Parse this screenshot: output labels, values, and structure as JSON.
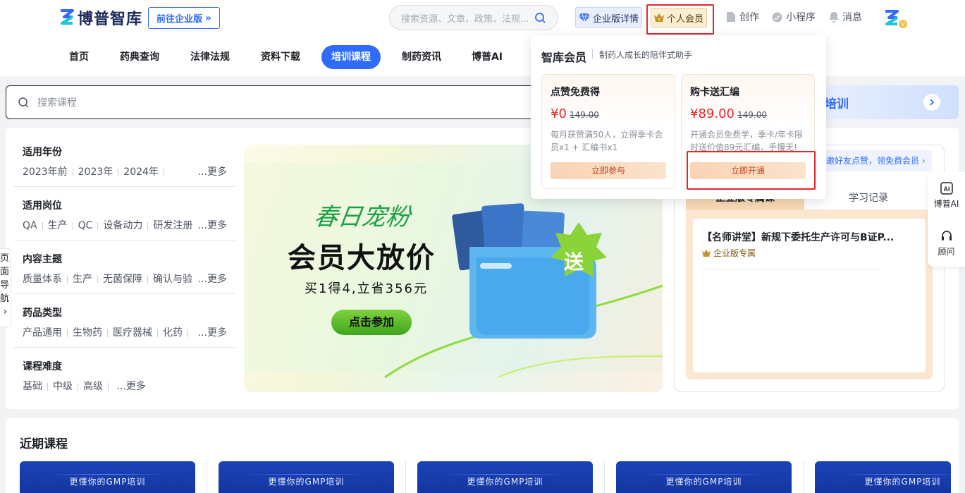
{
  "header": {
    "brand": "博普智库",
    "enterprise_switch": "前往企业版",
    "search_placeholder": "搜索资源、文章、政策、法规...",
    "enterprise_detail": "企业版详情",
    "personal_member": "个人会员",
    "links": [
      "创作",
      "小程序",
      "消息"
    ]
  },
  "nav": {
    "items": [
      "首页",
      "药典查询",
      "法律法规",
      "资料下载",
      "培训课程",
      "制药资讯",
      "博普AI"
    ],
    "active": "培训课程"
  },
  "course_search": {
    "placeholder": "搜索课程"
  },
  "promo_banner": {
    "label": "培训"
  },
  "filters": [
    {
      "title": "适用年份",
      "options": [
        "2023年前",
        "2023年",
        "2024年"
      ],
      "more": "...更多"
    },
    {
      "title": "适用岗位",
      "options": [
        "QA",
        "生产",
        "QC",
        "设备动力",
        "研发注册"
      ],
      "more": "...更多"
    },
    {
      "title": "内容主题",
      "options": [
        "质量体系",
        "生产",
        "无菌保障",
        "确认与验"
      ],
      "more": "...更多"
    },
    {
      "title": "药品类型",
      "options": [
        "产品通用",
        "生物药",
        "医疗器械",
        "化药"
      ],
      "more": "...更多"
    },
    {
      "title": "课程难度",
      "options": [
        "基础",
        "中级",
        "高级"
      ],
      "more": "...更多"
    }
  ],
  "side_nav": {
    "label": "页面导航"
  },
  "hero": {
    "cursive": "春日宠粉",
    "headline": "会员大放价",
    "subline": "买1得4,立省356元",
    "cta": "点击参加",
    "badge": "送"
  },
  "right_panel": {
    "invite": "邀好友点赞，领免费会员",
    "tabs": [
      "企业版专属课",
      "学习记录"
    ],
    "course_title": "【名师讲堂】新规下委托生产许可与B证P...",
    "course_tag": "企业版专属"
  },
  "floating": {
    "items": [
      "博普AI",
      "顾问"
    ]
  },
  "membership_dropdown": {
    "title": "智库会员",
    "subtitle": "制药人成长的陪伴式助手",
    "offers": [
      {
        "title": "点赞免费得",
        "price": "¥0",
        "original": "149.00",
        "desc": "每月获赞满50人，立得季卡会员x1 + 汇编书x1",
        "button": "立即参与"
      },
      {
        "title": "购卡送汇编",
        "price": "¥89.00",
        "original": "149.00",
        "desc": "开通会员免费学，季卡/年卡限时送价值89元汇编，手慢无!",
        "button": "立即开通"
      }
    ]
  },
  "recent": {
    "title": "近期课程",
    "cards": [
      "更懂你的GMP培训",
      "更懂你的GMP培训",
      "更懂你的GMP培训",
      "更懂你的GMP培训",
      "更懂你的GMP培训"
    ]
  },
  "colors": {
    "primary": "#2f6bff",
    "highlight_red": "#e5262c",
    "gold": "#fbeed3"
  }
}
